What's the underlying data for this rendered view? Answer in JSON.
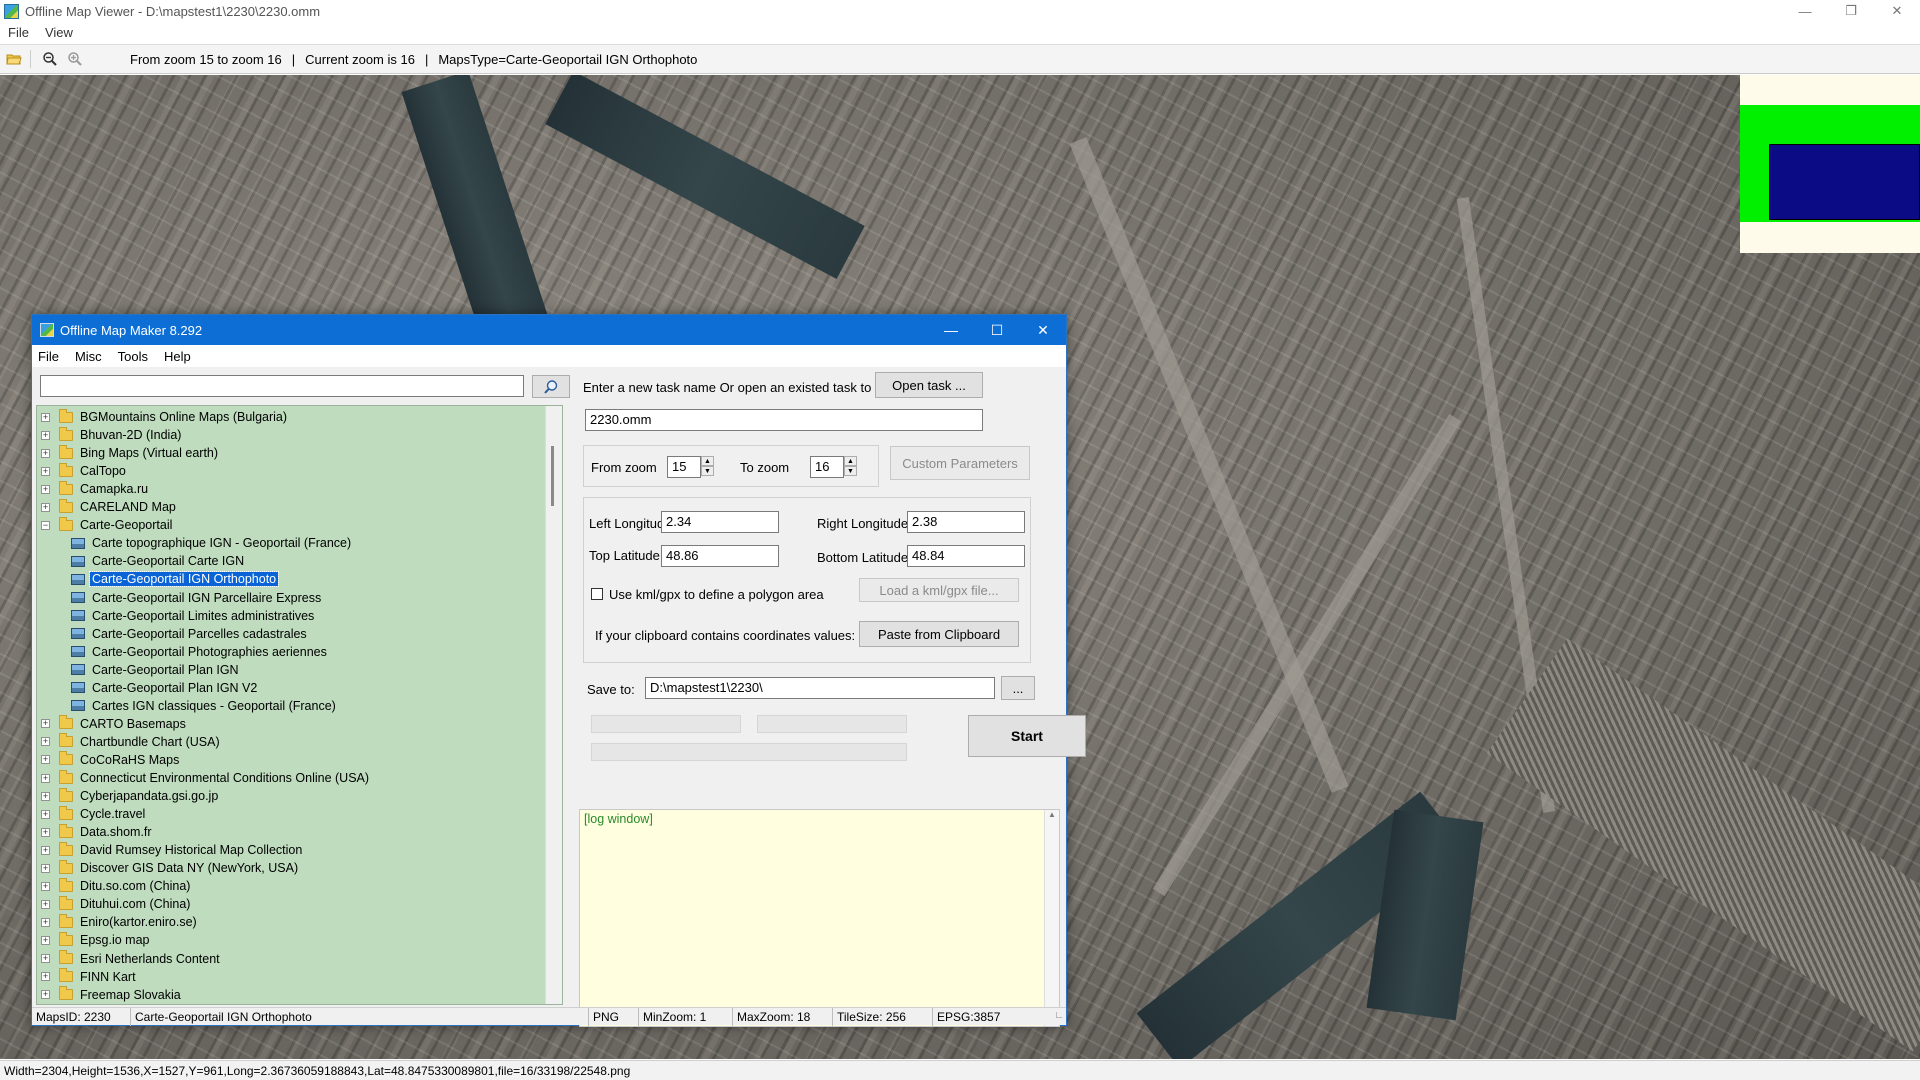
{
  "viewer": {
    "title": "Offline Map Viewer - D:\\mapstest1\\2230\\2230.omm",
    "menu": [
      "File",
      "View"
    ],
    "toolbar": {
      "zoom_range": "From zoom 15 to zoom 16",
      "current_zoom": "Current zoom is 16",
      "maps_type": "MapsType=Carte-Geoportail IGN Orthophoto",
      "pipe": "|"
    },
    "status": "Width=2304,Height=1536,X=1527,Y=961,Long=2.36736059188843,Lat=48.8475330089801,file=16/33198/22548.png"
  },
  "dialog": {
    "title": "Offline Map Maker 8.292",
    "menu": [
      "File",
      "Misc",
      "Tools",
      "Help"
    ],
    "search": {
      "value": "",
      "placeholder": ""
    },
    "tree": [
      {
        "label": "BGMountains Online Maps (Bulgaria)",
        "type": "folder",
        "expanded": false
      },
      {
        "label": "Bhuvan-2D (India)",
        "type": "folder",
        "expanded": false
      },
      {
        "label": "Bing Maps (Virtual earth)",
        "type": "folder",
        "expanded": false
      },
      {
        "label": "CalTopo",
        "type": "folder",
        "expanded": false
      },
      {
        "label": "Camapka.ru",
        "type": "folder",
        "expanded": false
      },
      {
        "label": "CARELAND Map",
        "type": "folder",
        "expanded": false
      },
      {
        "label": "Carte-Geoportail",
        "type": "folder",
        "expanded": true
      },
      {
        "label": "Carte topographique IGN - Geoportail (France)",
        "type": "leaf"
      },
      {
        "label": "Carte-Geoportail Carte IGN",
        "type": "leaf"
      },
      {
        "label": "Carte-Geoportail IGN Orthophoto",
        "type": "leaf",
        "selected": true
      },
      {
        "label": "Carte-Geoportail IGN Parcellaire Express",
        "type": "leaf"
      },
      {
        "label": "Carte-Geoportail Limites administratives",
        "type": "leaf"
      },
      {
        "label": "Carte-Geoportail Parcelles cadastrales",
        "type": "leaf"
      },
      {
        "label": "Carte-Geoportail Photographies aeriennes",
        "type": "leaf"
      },
      {
        "label": "Carte-Geoportail Plan IGN",
        "type": "leaf"
      },
      {
        "label": "Carte-Geoportail Plan IGN V2",
        "type": "leaf"
      },
      {
        "label": "Cartes IGN classiques - Geoportail (France)",
        "type": "leaf"
      },
      {
        "label": "CARTO Basemaps",
        "type": "folder",
        "expanded": false
      },
      {
        "label": "Chartbundle Chart (USA)",
        "type": "folder",
        "expanded": false
      },
      {
        "label": "CoCoRaHS Maps",
        "type": "folder",
        "expanded": false
      },
      {
        "label": "Connecticut Environmental Conditions Online (USA)",
        "type": "folder",
        "expanded": false
      },
      {
        "label": "Cyberjapandata.gsi.go.jp",
        "type": "folder",
        "expanded": false
      },
      {
        "label": "Cycle.travel",
        "type": "folder",
        "expanded": false
      },
      {
        "label": "Data.shom.fr",
        "type": "folder",
        "expanded": false
      },
      {
        "label": "David Rumsey Historical Map Collection",
        "type": "folder",
        "expanded": false
      },
      {
        "label": "Discover GIS Data NY (NewYork, USA)",
        "type": "folder",
        "expanded": false
      },
      {
        "label": "Ditu.so.com (China)",
        "type": "folder",
        "expanded": false
      },
      {
        "label": "Dituhui.com (China)",
        "type": "folder",
        "expanded": false
      },
      {
        "label": "Eniro(kartor.eniro.se)",
        "type": "folder",
        "expanded": false
      },
      {
        "label": "Epsg.io map",
        "type": "folder",
        "expanded": false
      },
      {
        "label": "Esri Netherlands Content",
        "type": "folder",
        "expanded": false
      },
      {
        "label": "FINN Kart",
        "type": "folder",
        "expanded": false
      },
      {
        "label": "Freemap Slovakia",
        "type": "folder",
        "expanded": false
      }
    ],
    "task": {
      "prompt": "Enter a new task name Or open an existed task to continue:",
      "open_button": "Open task ...",
      "name_value": "2230.omm"
    },
    "zoom": {
      "from_label": "From zoom",
      "from_value": "15",
      "to_label": "To zoom",
      "to_value": "16",
      "custom_button": "Custom Parameters"
    },
    "coords": {
      "left_lon_label": "Left Longitude",
      "left_lon_value": "2.34",
      "right_lon_label": "Right Longitude",
      "right_lon_value": "2.38",
      "top_lat_label": "Top Latitude",
      "top_lat_value": "48.86",
      "bottom_lat_label": "Bottom Latitude",
      "bottom_lat_value": "48.84",
      "kml_checkbox_label": "Use kml/gpx to define a polygon area",
      "kml_checked": false,
      "load_kml_button": "Load a kml/gpx file...",
      "clipboard_label": "If your clipboard contains coordinates values:",
      "paste_button": "Paste from Clipboard"
    },
    "save": {
      "label": "Save to:",
      "path": "D:\\mapstest1\\2230\\",
      "browse_button": "..."
    },
    "start_button": "Start",
    "log": "[log window]",
    "status": {
      "maps_id": "MapsID: 2230",
      "maps_name": "Carte-Geoportail IGN Orthophoto",
      "format": "PNG",
      "min_zoom": "MinZoom: 1",
      "max_zoom": "MaxZoom: 18",
      "tile_size": "TileSize: 256",
      "epsg": "EPSG:3857"
    }
  },
  "colors": {
    "dialog_titlebar": "#0d6fd6",
    "tree_background": "#bfdcbf",
    "selected_item": "#0a64d6",
    "log_background": "#ffffe0",
    "log_text": "#2a8a2a",
    "minimap_green": "#00f000",
    "minimap_blue": "#0b0b86"
  }
}
